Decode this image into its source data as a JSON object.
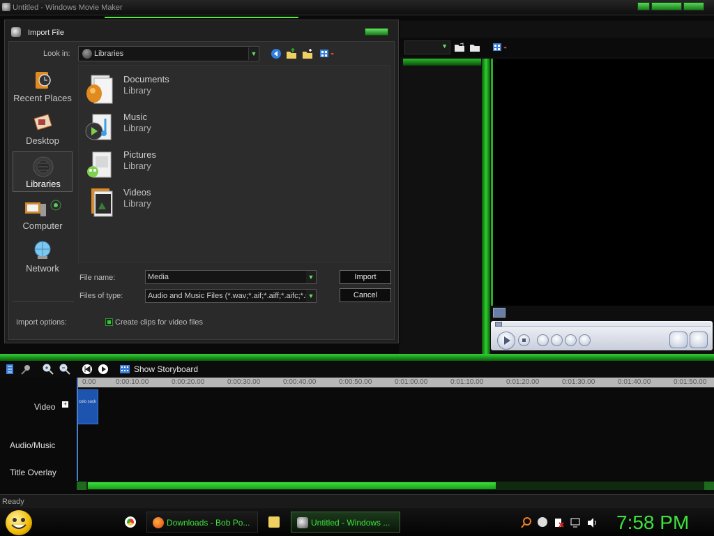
{
  "window": {
    "title": "Untitled - Windows Movie Maker"
  },
  "dialog": {
    "title": "Import File",
    "look_in_label": "Look in:",
    "look_in_value": "Libraries",
    "places": [
      {
        "label": "Recent Places",
        "icon": "recent-places-icon"
      },
      {
        "label": "Desktop",
        "icon": "desktop-icon"
      },
      {
        "label": "Libraries",
        "icon": "libraries-icon",
        "selected": true
      },
      {
        "label": "Computer",
        "icon": "computer-icon"
      },
      {
        "label": "Network",
        "icon": "network-icon"
      }
    ],
    "items": [
      {
        "name": "Documents",
        "type": "Library",
        "icon": "documents-library-icon"
      },
      {
        "name": "Music",
        "type": "Library",
        "icon": "music-library-icon"
      },
      {
        "name": "Pictures",
        "type": "Library",
        "icon": "pictures-library-icon"
      },
      {
        "name": "Videos",
        "type": "Library",
        "icon": "videos-library-icon"
      }
    ],
    "file_name_label": "File name:",
    "file_name_value": "Media",
    "files_of_type_label": "Files of type:",
    "files_of_type_value": "Audio and Music Files (*.wav;*.aif;*.aiff;*.aifc;*.snd",
    "import_button": "Import",
    "cancel_button": "Cancel",
    "import_options_label": "Import options:",
    "create_clips_label": "Create clips for video files",
    "create_clips_checked": true
  },
  "timeline": {
    "show_storyboard": "Show Storyboard",
    "ruler": [
      "0.00",
      "0:00:10.00",
      "0:00:20.00",
      "0:00:30.00",
      "0:00:40.00",
      "0:00:50.00",
      "0:01:00.00",
      "0:01:10.00",
      "0:01:20.00",
      "0:01:30.00",
      "0:01:40.00",
      "0:01:50.00"
    ],
    "tracks": [
      "Video",
      "Audio/Music",
      "Title Overlay"
    ],
    "expand_symbol": "+",
    "clip_text": "colo suck"
  },
  "status": {
    "text": "Ready"
  },
  "taskbar": {
    "buttons": [
      {
        "label": "Downloads - Bob Po...",
        "icon": "firefox-icon"
      },
      {
        "label": "Untitled - Windows ...",
        "icon": "movie-maker-icon",
        "active": true
      }
    ],
    "clock": "7:58 PM"
  },
  "colors": {
    "accent": "#3de23d",
    "dialog_bg": "#202020",
    "clip_blue": "#1d54b0"
  }
}
